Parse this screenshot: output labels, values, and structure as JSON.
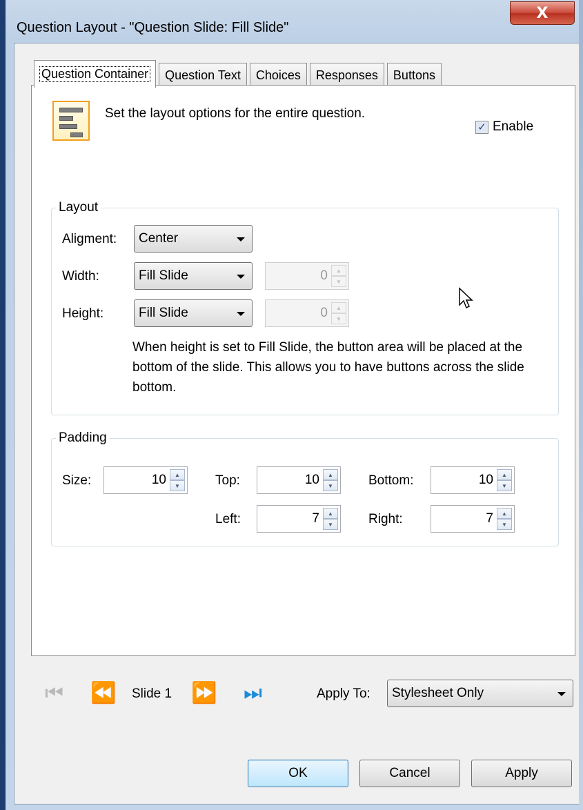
{
  "window": {
    "title": "Question Layout - \"Question Slide: Fill Slide\"",
    "close_glyph": "X"
  },
  "tabs": [
    {
      "label": "Question Container",
      "active": true
    },
    {
      "label": "Question Text",
      "active": false
    },
    {
      "label": "Choices",
      "active": false
    },
    {
      "label": "Responses",
      "active": false
    },
    {
      "label": "Buttons",
      "active": false
    }
  ],
  "header": {
    "text": "Set the layout options for the entire question.",
    "enable_label": "Enable",
    "enable_checked": true,
    "check_glyph": "✓"
  },
  "layout": {
    "legend": "Layout",
    "alignment_label": "Aligment:",
    "alignment_value": "Center",
    "width_label": "Width:",
    "width_value": "Fill Slide",
    "width_number": "0",
    "height_label": "Height:",
    "height_value": "Fill Slide",
    "height_number": "0",
    "note": "When height is set to Fill Slide, the button area will be placed at the bottom of the slide. This allows you to have buttons across the slide bottom."
  },
  "padding": {
    "legend": "Padding",
    "size_label": "Size:",
    "size_value": "10",
    "top_label": "Top:",
    "top_value": "10",
    "bottom_label": "Bottom:",
    "bottom_value": "10",
    "left_label": "Left:",
    "left_value": "7",
    "right_label": "Right:",
    "right_value": "7"
  },
  "navigation": {
    "first_glyph": "⏮",
    "prev_glyph": "⏪",
    "next_glyph": "⏩",
    "last_glyph": "⏭",
    "slide_label": "Slide 1"
  },
  "apply_to": {
    "label": "Apply To:",
    "value": "Stylesheet Only"
  },
  "buttons": {
    "ok": "OK",
    "cancel": "Cancel",
    "apply": "Apply"
  }
}
